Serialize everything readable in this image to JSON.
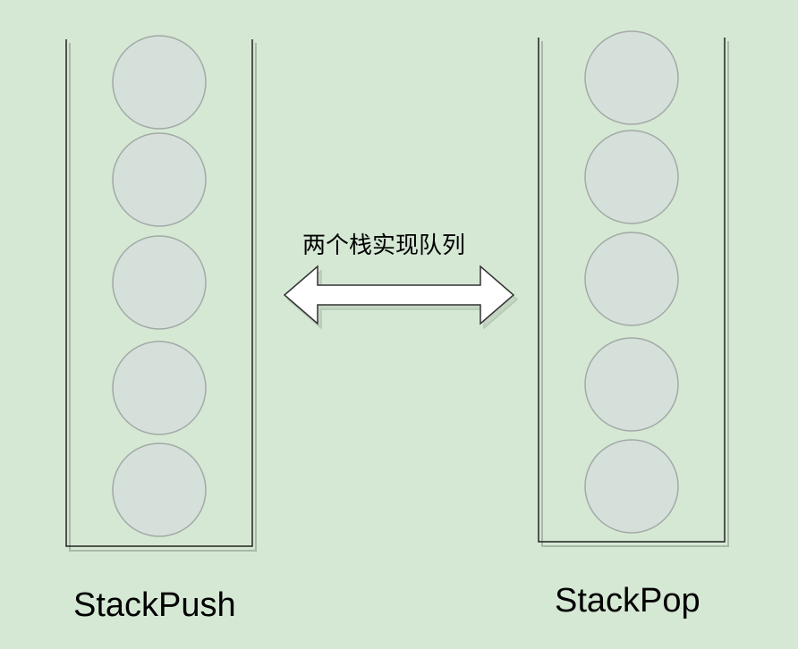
{
  "diagram": {
    "background_color": "#d5e8d4",
    "left_stack": {
      "label": "StackPush",
      "element_count": 5
    },
    "right_stack": {
      "label": "StackPop",
      "element_count": 5
    },
    "arrow": {
      "caption": "两个栈实现队列",
      "direction": "bidirectional"
    },
    "colors": {
      "stack_element_fill": "#d5e0da",
      "stack_element_stroke": "#a3a9a6",
      "container_stroke": "#222222",
      "arrow_fill": "#ffffff",
      "arrow_stroke": "#333333"
    }
  }
}
